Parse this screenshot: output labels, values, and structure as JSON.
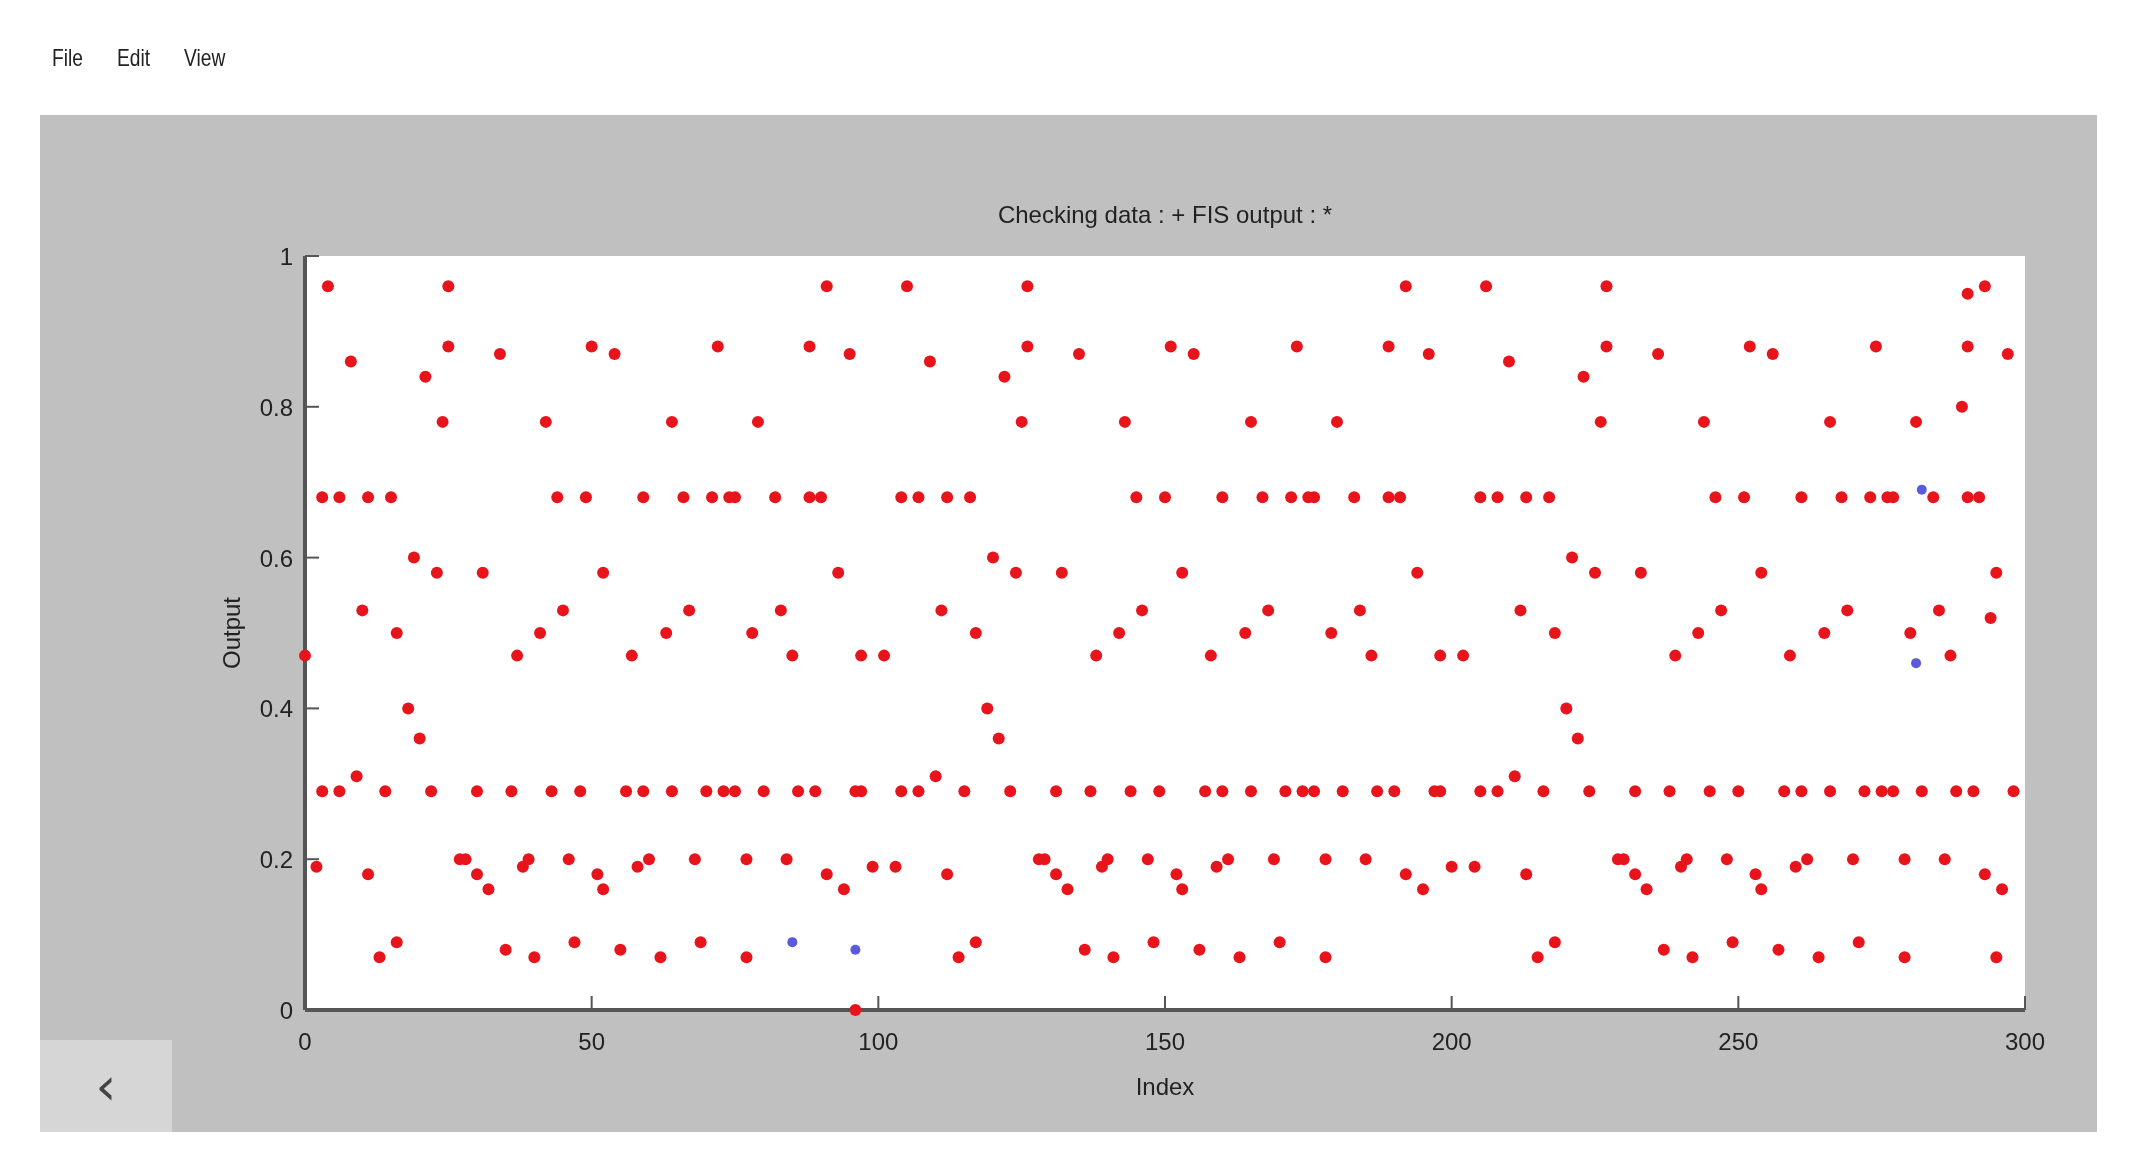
{
  "menu": [
    {
      "label": "File"
    },
    {
      "label": "Edit"
    },
    {
      "label": "View"
    }
  ],
  "back_button": {
    "label": "‹"
  },
  "chart_data": {
    "type": "scatter",
    "title": "Checking data : +   FIS output : *",
    "xlabel": "Index",
    "ylabel": "Output",
    "xlim": [
      0,
      300
    ],
    "ylim": [
      0,
      1
    ],
    "xticks": [
      0,
      50,
      100,
      150,
      200,
      250,
      300
    ],
    "yticks": [
      0,
      {
        "value": 0.2,
        "label": "0.2"
      },
      {
        "value": 0.4,
        "label": "0.4"
      },
      {
        "value": 0.6,
        "label": "0.6"
      },
      {
        "value": 0.8,
        "label": "0.8"
      },
      1
    ],
    "series": [
      {
        "color": "#5a5adc",
        "x": [
          85,
          96,
          282,
          281
        ],
        "values": [
          0.09,
          0.08,
          0.69,
          0.46
        ]
      },
      {
        "color": "#e8141c",
        "x": [
          0,
          4,
          3,
          6,
          8,
          9,
          10,
          11,
          15,
          3,
          6,
          2,
          11,
          13,
          16,
          14,
          16,
          18,
          20,
          19,
          21,
          22,
          23,
          24,
          25,
          25,
          27,
          28,
          30,
          32,
          30,
          31,
          34,
          35,
          36,
          37,
          38,
          39,
          40,
          41,
          42,
          43,
          44,
          45,
          46,
          47,
          48,
          49,
          50,
          51,
          52,
          52,
          54,
          55,
          56,
          57,
          58,
          59,
          59,
          60,
          62,
          63,
          64,
          64,
          66,
          67,
          68,
          69,
          70,
          71,
          72,
          73,
          74,
          75,
          75,
          77,
          77,
          78,
          79,
          80,
          82,
          83,
          84,
          85,
          86,
          88,
          88,
          90,
          89,
          91,
          91,
          93,
          94,
          95,
          96,
          97,
          97,
          96,
          99,
          101,
          105,
          104,
          107,
          109,
          110,
          111,
          112,
          116,
          104,
          107,
          103,
          112,
          114,
          117,
          115,
          117,
          119,
          121,
          120,
          122,
          123,
          124,
          125,
          126,
          126,
          128,
          129,
          131,
          133,
          131,
          132,
          135,
          136,
          137,
          138,
          139,
          140,
          141,
          142,
          143,
          144,
          145,
          146,
          147,
          148,
          149,
          150,
          151,
          152,
          153,
          153,
          155,
          156,
          157,
          158,
          159,
          160,
          160,
          161,
          163,
          164,
          165,
          165,
          167,
          168,
          169,
          170,
          171,
          172,
          173,
          174,
          175,
          176,
          176,
          178,
          178,
          179,
          180,
          181,
          183,
          184,
          185,
          186,
          187,
          189,
          189,
          191,
          190,
          192,
          192,
          194,
          195,
          196,
          197,
          198,
          198,
          200,
          202,
          206,
          205,
          208,
          210,
          211,
          212,
          213,
          217,
          205,
          208,
          204,
          213,
          215,
          218,
          216,
          218,
          220,
          222,
          221,
          223,
          224,
          225,
          226,
          227,
          227,
          229,
          230,
          232,
          234,
          232,
          233,
          236,
          237,
          238,
          239,
          240,
          241,
          242,
          243,
          244,
          245,
          246,
          247,
          248,
          249,
          250,
          251,
          252,
          253,
          254,
          254,
          256,
          257,
          258,
          259,
          260,
          261,
          261,
          262,
          264,
          265,
          266,
          266,
          268,
          269,
          270,
          271,
          272,
          273,
          274,
          275,
          276,
          277,
          277,
          279,
          279,
          280,
          281,
          282,
          284,
          285,
          286,
          287,
          288,
          290,
          290,
          292,
          291,
          293,
          293,
          295,
          296,
          297,
          298,
          289,
          290,
          294,
          295
        ],
        "values": [
          0.47,
          0.96,
          0.68,
          0.68,
          0.86,
          0.31,
          0.53,
          0.68,
          0.68,
          0.29,
          0.29,
          0.19,
          0.18,
          0.07,
          0.09,
          0.29,
          0.5,
          0.4,
          0.36,
          0.6,
          0.84,
          0.29,
          0.58,
          0.78,
          0.96,
          0.88,
          0.2,
          0.2,
          0.18,
          0.16,
          0.29,
          0.58,
          0.87,
          0.08,
          0.29,
          0.47,
          0.19,
          0.2,
          0.07,
          0.5,
          0.78,
          0.29,
          0.68,
          0.53,
          0.2,
          0.09,
          0.29,
          0.68,
          0.88,
          0.18,
          0.58,
          0.16,
          0.87,
          0.08,
          0.29,
          0.47,
          0.19,
          0.29,
          0.68,
          0.2,
          0.07,
          0.5,
          0.78,
          0.29,
          0.68,
          0.53,
          0.2,
          0.09,
          0.29,
          0.68,
          0.88,
          0.29,
          0.68,
          0.68,
          0.29,
          0.2,
          0.07,
          0.5,
          0.78,
          0.29,
          0.68,
          0.53,
          0.2,
          0.47,
          0.29,
          0.88,
          0.68,
          0.68,
          0.29,
          0.96,
          0.18,
          0.58,
          0.16,
          0.87,
          0.29,
          0.29,
          0.47,
          0,
          0.19,
          0.47,
          0.96,
          0.68,
          0.68,
          0.86,
          0.31,
          0.53,
          0.68,
          0.68,
          0.29,
          0.29,
          0.19,
          0.18,
          0.07,
          0.09,
          0.29,
          0.5,
          0.4,
          0.36,
          0.6,
          0.84,
          0.29,
          0.58,
          0.78,
          0.96,
          0.88,
          0.2,
          0.2,
          0.18,
          0.16,
          0.29,
          0.58,
          0.87,
          0.08,
          0.29,
          0.47,
          0.19,
          0.2,
          0.07,
          0.5,
          0.78,
          0.29,
          0.68,
          0.53,
          0.2,
          0.09,
          0.29,
          0.68,
          0.88,
          0.18,
          0.58,
          0.16,
          0.87,
          0.08,
          0.29,
          0.47,
          0.19,
          0.29,
          0.68,
          0.2,
          0.07,
          0.5,
          0.78,
          0.29,
          0.68,
          0.53,
          0.2,
          0.09,
          0.29,
          0.68,
          0.88,
          0.29,
          0.68,
          0.68,
          0.29,
          0.2,
          0.07,
          0.5,
          0.78,
          0.29,
          0.68,
          0.53,
          0.2,
          0.47,
          0.29,
          0.88,
          0.68,
          0.68,
          0.29,
          0.96,
          0.18,
          0.58,
          0.16,
          0.87,
          0.29,
          0.29,
          0.47,
          0.19,
          0.47,
          0.96,
          0.68,
          0.68,
          0.86,
          0.31,
          0.53,
          0.68,
          0.68,
          0.29,
          0.29,
          0.19,
          0.18,
          0.07,
          0.09,
          0.29,
          0.5,
          0.4,
          0.36,
          0.6,
          0.84,
          0.29,
          0.58,
          0.78,
          0.96,
          0.88,
          0.2,
          0.2,
          0.18,
          0.16,
          0.29,
          0.58,
          0.87,
          0.08,
          0.29,
          0.47,
          0.19,
          0.2,
          0.07,
          0.5,
          0.78,
          0.29,
          0.68,
          0.53,
          0.2,
          0.09,
          0.29,
          0.68,
          0.88,
          0.18,
          0.58,
          0.16,
          0.87,
          0.08,
          0.29,
          0.47,
          0.19,
          0.29,
          0.68,
          0.2,
          0.07,
          0.5,
          0.78,
          0.29,
          0.68,
          0.53,
          0.2,
          0.09,
          0.29,
          0.68,
          0.88,
          0.29,
          0.68,
          0.68,
          0.29,
          0.2,
          0.07,
          0.5,
          0.78,
          0.29,
          0.68,
          0.53,
          0.2,
          0.47,
          0.29,
          0.88,
          0.68,
          0.68,
          0.29,
          0.96,
          0.18,
          0.58,
          0.16,
          0.87,
          0.29,
          0.8,
          0.95,
          0.52,
          0.07
        ]
      }
    ]
  }
}
